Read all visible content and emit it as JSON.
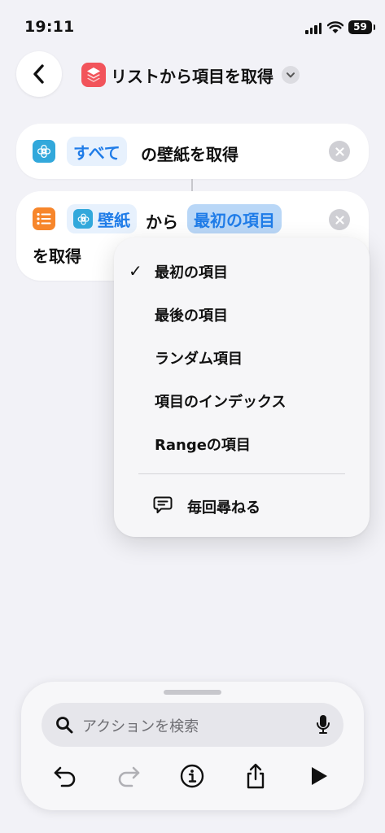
{
  "status_bar": {
    "time": "19:11",
    "battery": "59"
  },
  "nav": {
    "title": "リストから項目を取得"
  },
  "actions": [
    {
      "token": "すべて",
      "suffix": "の壁紙を取得"
    },
    {
      "input_token": "壁紙",
      "connector": "から",
      "selected_token": "最初の項目",
      "suffix": "を取得"
    }
  ],
  "menu": {
    "items": [
      {
        "label": "最初の項目",
        "checked": true
      },
      {
        "label": "最後の項目",
        "checked": false
      },
      {
        "label": "ランダム項目",
        "checked": false
      },
      {
        "label": "項目のインデックス",
        "checked": false
      },
      {
        "label": "Rangeの項目",
        "checked": false
      }
    ],
    "ask_label": "毎回尋ねる",
    "check_glyph": "✓"
  },
  "search": {
    "placeholder": "アクションを検索"
  },
  "colors": {
    "accent": "#1f7ce8",
    "app_icon": "#f2545b",
    "wallpaper_icon": "#32a8db",
    "list_icon": "#f7862b"
  }
}
